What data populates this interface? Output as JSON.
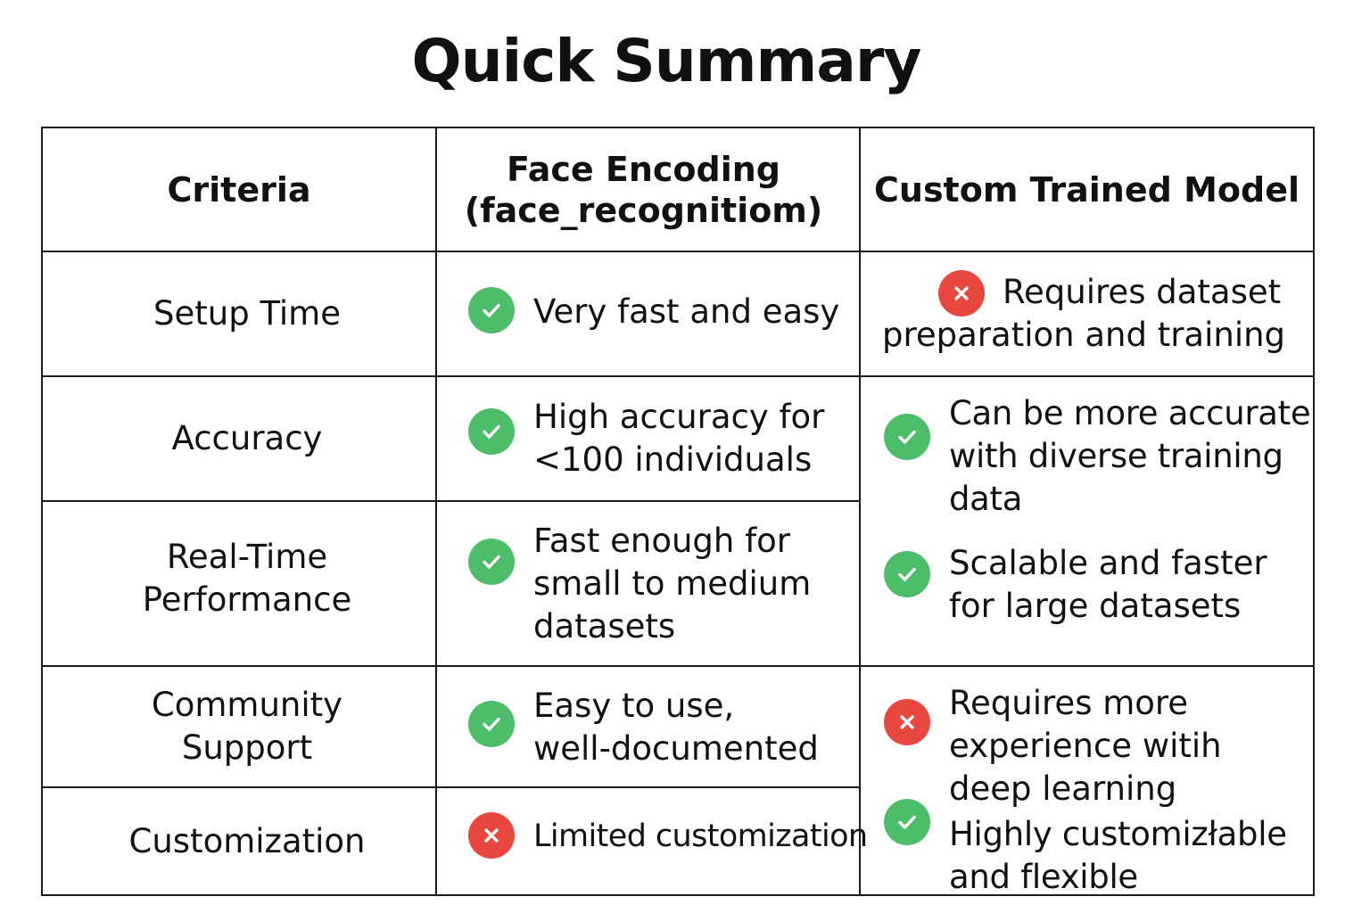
{
  "title": "Quick Summary",
  "headers": {
    "criteria": "Criteria",
    "face_encoding": "Face Encoding\n(face_recognitiom)",
    "custom_model": "Custom Trained Model"
  },
  "criteria": {
    "setup_time": "Setup Time",
    "accuracy": "Accuracy",
    "realtime": "Real-Time\nPerformance",
    "community": "Community\nSupport",
    "customization": "Customization"
  },
  "face_encoding": {
    "setup_time": {
      "status": "check",
      "text": "Very fast and easy"
    },
    "accuracy": {
      "status": "check",
      "text": "High accuracy for\n<100 individuals"
    },
    "realtime": {
      "status": "check",
      "text": "Fast enough for\nsmall to medium\ndatasets"
    },
    "community": {
      "status": "check",
      "text": "Easy to use,\nwell-documented"
    },
    "customization": {
      "status": "cross",
      "text": "Limited customization"
    }
  },
  "custom_model": {
    "setup_time": {
      "status": "cross",
      "text": "Requires dataset\npreparation and training"
    },
    "accuracy": {
      "status": "check",
      "text": "Can be more accurate\nwith diverse training\ndata"
    },
    "realtime": {
      "status": "check",
      "text": "Scalable and faster\nfor large datasets"
    },
    "community": {
      "status": "cross",
      "text": "Requires more\nexperience witih\ndeep learning"
    },
    "customization": {
      "status": "check",
      "text": "Highly customizłable\nand flexible"
    }
  },
  "colors": {
    "check": "#4dbd6a",
    "cross": "#e8473f",
    "border": "#1a1a1a"
  },
  "icons": {
    "check": "check-circle-icon",
    "cross": "cross-circle-icon"
  }
}
